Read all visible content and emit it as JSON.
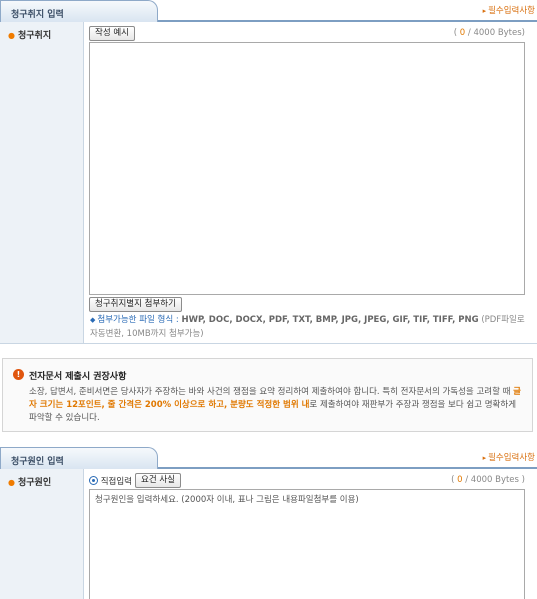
{
  "section1": {
    "tab_title": "청구취지 입력",
    "required_note": "필수입력사항",
    "field_label": "청구취지",
    "example_button": "작성 예시",
    "counter_open": "( ",
    "counter_value": "0",
    "counter_rest": " / 4000 Bytes)",
    "attach_button": "청구취지별지 첨부하기",
    "filetypes_label": "첨부가능한 파일 형식 :",
    "filetypes_list": "HWP, DOC, DOCX, PDF, TXT, BMP, JPG, JPEG, GIF, TIF, TIFF, PNG",
    "filetypes_note": "(PDF파일로 자동변환, 10MB까지 첨부가능)"
  },
  "notice": {
    "title": "전자문서 제출시 권장사항",
    "body_1": "소장, 답변서, 준비서면은 당사자가 주장하는 바와 사건의 쟁점을 요약 정리하여 제출하여야 합니다. 특히 전자문서의 가독성을 고려할 때 ",
    "highlight": "글자 크기는 12포인트, 줄 간격은 200% 이상으로 하고, 분량도 적정한 범위 내",
    "body_2": "로 제출하여야 재판부가 주장과 쟁점을 보다 쉽고 명확하게 파악할 수 있습니다."
  },
  "section2": {
    "tab_title": "청구원인 입력",
    "required_note": "필수입력사항",
    "field_label": "청구원인",
    "direct_input_label": "직접입력",
    "facts_button": "요건 사실",
    "counter_open": "( ",
    "counter_value": "0",
    "counter_rest": " / 4000 Bytes )",
    "textarea_value": "청구원인을 입력하세요. (2000자 이내, 표나 그림은 내용파일첨부를 이용)"
  },
  "colors": {
    "accent_orange": "#e07800",
    "header_blue": "#7d9ec2",
    "link_blue": "#2a6bb6"
  }
}
